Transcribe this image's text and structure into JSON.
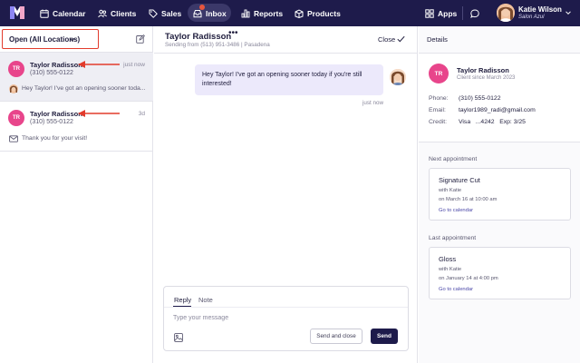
{
  "nav": {
    "items": [
      {
        "label": "Calendar",
        "icon": "calendar-icon"
      },
      {
        "label": "Clients",
        "icon": "clients-icon"
      },
      {
        "label": "Sales",
        "icon": "tag-icon"
      },
      {
        "label": "Inbox",
        "icon": "inbox-icon"
      },
      {
        "label": "Reports",
        "icon": "bar-chart-icon"
      },
      {
        "label": "Products",
        "icon": "box-icon"
      }
    ],
    "apps_label": "Apps",
    "user": {
      "name": "Katie Wilson",
      "salon": "Salon Azul"
    },
    "colors": {
      "bar": "#1e1b4b",
      "active_pill": "#3b3869",
      "badge": "#e8553d"
    }
  },
  "inbox": {
    "filter_label": "Open (All Locations)",
    "conversations": [
      {
        "initials": "TR",
        "name": "Taylor Radisson",
        "phone": "(310) 555-0122",
        "time": "just now",
        "preview": "Hey Taylor! I've got an opening sooner toda...",
        "preview_icon": "staff-avatar-icon",
        "active": true
      },
      {
        "initials": "TR",
        "name": "Taylor Radisson",
        "phone": "(310) 555-0122",
        "time": "3d",
        "preview": "Thank you for your visit!",
        "preview_icon": "envelope-icon",
        "active": false
      }
    ]
  },
  "thread": {
    "title": "Taylor Radisson",
    "more": "•••",
    "subtitle": "Sending from (513) 951-3486 | Pasadena",
    "close_label": "Close",
    "message": {
      "text": "Hey Taylor! I've got an opening sooner today if you're still interested!",
      "time": "just now"
    },
    "composer": {
      "tab_reply": "Reply",
      "tab_note": "Note",
      "placeholder": "Type your message",
      "send_close_label": "Send and close",
      "send_label": "Send"
    }
  },
  "details": {
    "title": "Details",
    "client": {
      "initials": "TR",
      "name": "Taylor Radisson",
      "since": "Client since March 2023",
      "phone_label": "Phone:",
      "phone": "(310) 555-0122",
      "email_label": "Email:",
      "email": "taylor1989_radi@gmail.com",
      "credit_label": "Credit:",
      "credit": "Visa   ...4242   Exp: 3/25"
    },
    "next": {
      "section_title": "Next appointment",
      "service": "Signature Cut",
      "with": "with Katie",
      "when": "on March 16 at 10:00 am",
      "link": "Go to calendar"
    },
    "last": {
      "section_title": "Last appointment",
      "service": "Gloss",
      "with": "with Katie",
      "when": "on January 14 at 4:00 pm",
      "link": "Go to calendar"
    }
  }
}
